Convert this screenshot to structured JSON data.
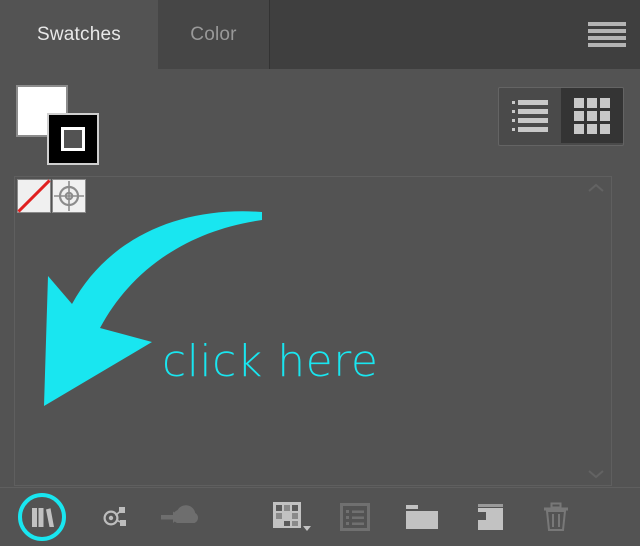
{
  "panel": {
    "tabs": [
      {
        "label": "Swatches",
        "active": true
      },
      {
        "label": "Color",
        "active": false
      }
    ],
    "menu_icon": "hamburger-menu-icon"
  },
  "proxies": {
    "fill_label": "Fill",
    "fill_color": "#ffffff",
    "stroke_label": "Stroke",
    "stroke_color": "#000000"
  },
  "view_toggle": {
    "list_label": "List View",
    "grid_label": "Grid View",
    "selected": "Grid View"
  },
  "swatches": [
    {
      "name": "None",
      "icon": "none-swatch-icon"
    },
    {
      "name": "Registration",
      "icon": "registration-swatch-icon"
    }
  ],
  "scrollbar": {
    "up_label": "Scroll Up",
    "down_label": "Scroll Down"
  },
  "annotation": {
    "text": "click here",
    "color": "#19E6F0",
    "arrow_target": "Swatch Libraries menu"
  },
  "toolbar": {
    "buttons": [
      {
        "name": "swatch-libraries-menu",
        "label": "Swatch Libraries menu",
        "icon": "books-icon",
        "highlighted": true,
        "enabled": true
      },
      {
        "name": "color-themes",
        "label": "Color Themes panel",
        "icon": "color-group-node-icon",
        "highlighted": false,
        "enabled": true
      },
      {
        "name": "add-to-library",
        "label": "Add selected swatch to My Library",
        "icon": "cloud-upload-icon",
        "highlighted": false,
        "enabled": false
      },
      {
        "name": "show-swatch-kinds-menu",
        "label": "Show Swatch Kinds menu",
        "icon": "swatch-grid-icon",
        "highlighted": false,
        "enabled": true
      },
      {
        "name": "swatch-options",
        "label": "Swatch Options",
        "icon": "swatch-options-list-icon",
        "highlighted": false,
        "enabled": false
      },
      {
        "name": "new-color-group",
        "label": "New Color Group",
        "icon": "folder-icon",
        "highlighted": false,
        "enabled": true
      },
      {
        "name": "new-swatch",
        "label": "New Swatch",
        "icon": "new-page-icon",
        "highlighted": false,
        "enabled": true
      },
      {
        "name": "delete-swatch",
        "label": "Delete Swatch",
        "icon": "trash-icon",
        "highlighted": false,
        "enabled": false
      }
    ]
  },
  "colors": {
    "panel_bg": "#535353",
    "tabbar_bg": "#3f3f3f",
    "inactive_tab_bg": "#464646",
    "accent_cyan": "#19E6F0",
    "icon_gray": "#c2c2c2",
    "icon_dim": "#6e6e6e"
  }
}
